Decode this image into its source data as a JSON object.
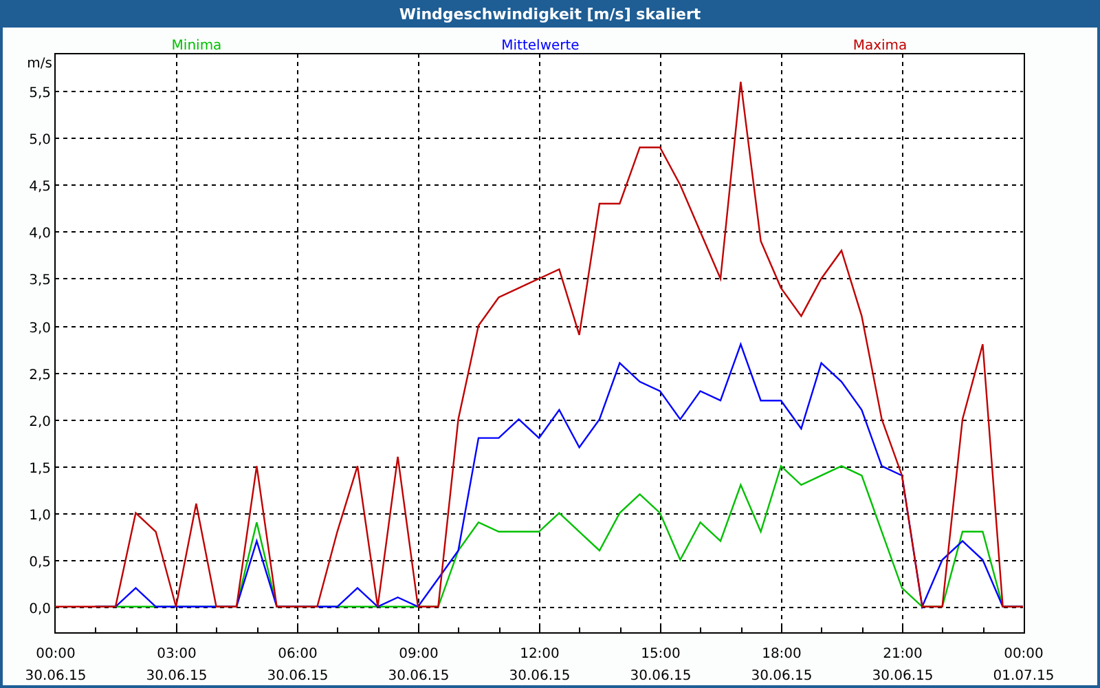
{
  "chart_data": {
    "type": "line",
    "title": "Windgeschwindigkeit [m/s] skaliert",
    "ylabel": "m/s",
    "categories": [
      "00:00 30.06.15",
      null,
      null,
      null,
      null,
      null,
      "03:00 30.06.15",
      null,
      null,
      null,
      null,
      null,
      "06:00 30.06.15",
      null,
      null,
      null,
      null,
      null,
      "09:00 30.06.15",
      null,
      null,
      null,
      null,
      null,
      "12:00 30.06.15",
      null,
      null,
      null,
      null,
      null,
      "15:00 30.06.15",
      null,
      null,
      null,
      null,
      null,
      "18:00 30.06.15",
      null,
      null,
      null,
      null,
      null,
      "21:00 30.06.15",
      null,
      null,
      null,
      null,
      null,
      "00:00 01.07.15"
    ],
    "series": [
      {
        "name": "Minima",
        "color": "#00c000",
        "values": [
          null,
          null,
          0,
          0,
          0,
          0,
          0,
          0,
          0,
          0,
          0.9,
          0,
          0,
          0,
          0,
          0,
          0,
          0,
          0,
          0,
          0.6,
          0.9,
          0.8,
          0.8,
          0.8,
          1.0,
          0.8,
          0.6,
          1.0,
          1.2,
          1.0,
          0.5,
          0.9,
          0.7,
          1.3,
          0.8,
          1.5,
          1.3,
          1.4,
          1.5,
          1.4,
          0.8,
          0.2,
          0,
          0,
          0.8,
          0.8,
          0,
          0
        ]
      },
      {
        "name": "Mittelwerte",
        "color": "#0000ff",
        "values": [
          null,
          null,
          0,
          0,
          0.2,
          0,
          0,
          0,
          0,
          0,
          0.7,
          0,
          0,
          0,
          0,
          0.2,
          0,
          0.1,
          0,
          0.3,
          0.6,
          1.8,
          1.8,
          2.0,
          1.8,
          2.1,
          1.7,
          2.0,
          2.6,
          2.4,
          2.3,
          2.0,
          2.3,
          2.2,
          2.8,
          2.2,
          2.2,
          1.9,
          2.6,
          2.4,
          2.1,
          1.5,
          1.4,
          0,
          0.5,
          0.7,
          0.5,
          0,
          0
        ]
      },
      {
        "name": "Maxima",
        "color": "#c00000",
        "values": [
          0,
          0,
          0,
          0,
          1.0,
          0.8,
          0,
          1.1,
          0,
          0,
          1.5,
          0,
          0,
          0,
          0.8,
          1.5,
          0,
          1.6,
          0,
          0,
          2.0,
          3.0,
          3.3,
          3.4,
          3.5,
          3.6,
          2.9,
          4.3,
          4.3,
          4.9,
          4.9,
          4.5,
          4.0,
          3.5,
          5.6,
          3.9,
          3.4,
          3.1,
          3.5,
          3.8,
          3.1,
          2.0,
          1.4,
          0,
          0,
          2.0,
          2.8,
          0,
          0
        ]
      }
    ],
    "ylim": [
      -0.28,
      5.9
    ],
    "grid": true,
    "yticks": [
      {
        "value": 0,
        "label": "0,0"
      },
      {
        "value": 0.5,
        "label": "0,5"
      },
      {
        "value": 1,
        "label": "1,0"
      },
      {
        "value": 1.5,
        "label": "1,5"
      },
      {
        "value": 2,
        "label": "2,0"
      },
      {
        "value": 2.5,
        "label": "2,5"
      },
      {
        "value": 3,
        "label": "3,0"
      },
      {
        "value": 3.5,
        "label": "3,5"
      },
      {
        "value": 4,
        "label": "4,0"
      },
      {
        "value": 4.5,
        "label": "4,5"
      },
      {
        "value": 5,
        "label": "5,0"
      },
      {
        "value": 5.5,
        "label": "5,5"
      }
    ]
  }
}
